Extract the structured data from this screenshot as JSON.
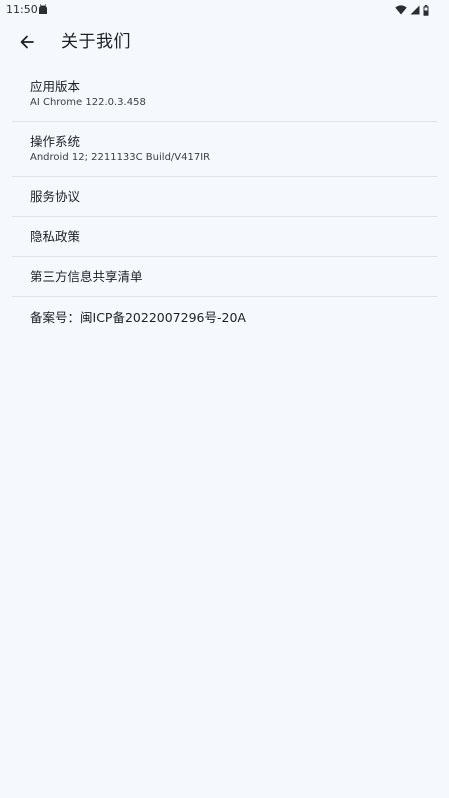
{
  "status_bar": {
    "time": "11:50",
    "icons": [
      "android-icon",
      "wifi-icon",
      "cell-signal-icon",
      "battery-icon"
    ]
  },
  "header": {
    "back_icon": "arrow-left-icon",
    "title": "关于我们"
  },
  "items": [
    {
      "title": "应用版本",
      "subtitle": "AI Chrome 122.0.3.458"
    },
    {
      "title": "操作系统",
      "subtitle": "Android 12; 2211133C Build/V417IR"
    },
    {
      "title": "服务协议"
    },
    {
      "title": "隐私政策"
    },
    {
      "title": "第三方信息共享清单"
    }
  ],
  "beian": {
    "label": "备案号：",
    "value": "闽ICP备2022007296号-20A"
  },
  "colors": {
    "background": "#f5f9fd",
    "divider": "#dfe3e8",
    "text": "#1d1f24"
  }
}
